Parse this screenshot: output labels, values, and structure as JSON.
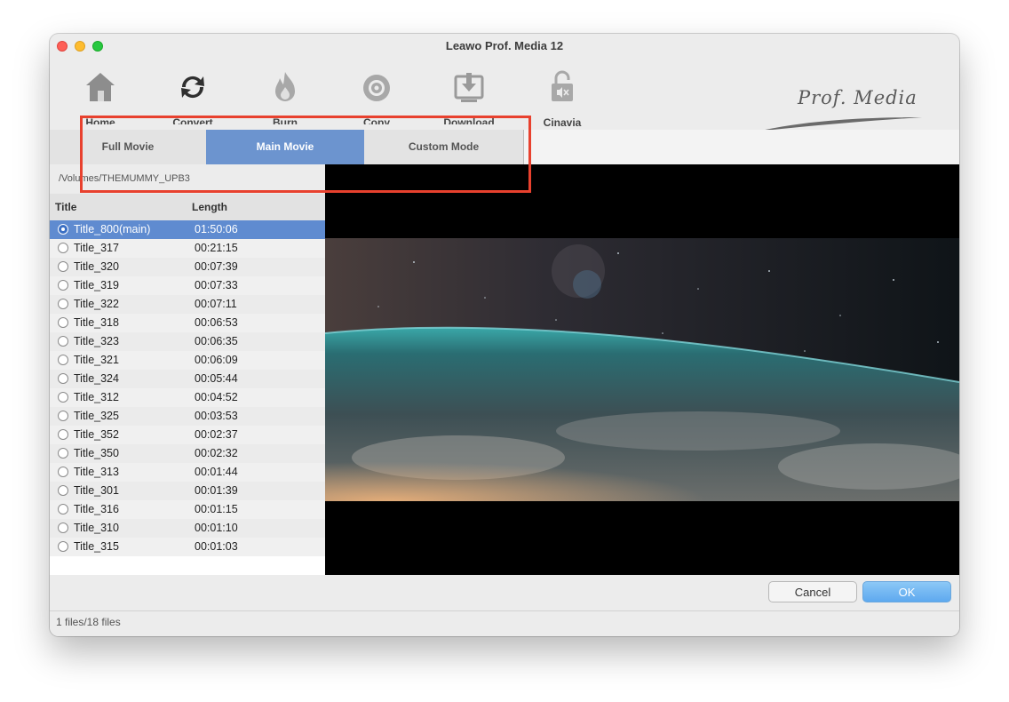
{
  "window": {
    "title": "Leawo Prof. Media 12"
  },
  "toolbar": {
    "items": [
      {
        "label": "Home",
        "icon": "home-icon"
      },
      {
        "label": "Convert",
        "icon": "convert-icon"
      },
      {
        "label": "Burn",
        "icon": "burn-icon"
      },
      {
        "label": "Copy",
        "icon": "copy-icon"
      },
      {
        "label": "Download",
        "icon": "download-icon"
      },
      {
        "label": "Cinavia",
        "icon": "cinavia-icon"
      }
    ],
    "logo_text": "Prof. Media"
  },
  "tabs": [
    {
      "label": "Full Movie",
      "active": false
    },
    {
      "label": "Main Movie",
      "active": true
    },
    {
      "label": "Custom Mode",
      "active": false
    }
  ],
  "path": "/Volumes/THEMUMMY_UPB3",
  "list": {
    "headers": {
      "title": "Title",
      "length": "Length"
    },
    "rows": [
      {
        "title": "Title_800(main)",
        "length": "01:50:06",
        "selected": true
      },
      {
        "title": "Title_317",
        "length": "00:21:15",
        "selected": false
      },
      {
        "title": "Title_320",
        "length": "00:07:39",
        "selected": false
      },
      {
        "title": "Title_319",
        "length": "00:07:33",
        "selected": false
      },
      {
        "title": "Title_322",
        "length": "00:07:11",
        "selected": false
      },
      {
        "title": "Title_318",
        "length": "00:06:53",
        "selected": false
      },
      {
        "title": "Title_323",
        "length": "00:06:35",
        "selected": false
      },
      {
        "title": "Title_321",
        "length": "00:06:09",
        "selected": false
      },
      {
        "title": "Title_324",
        "length": "00:05:44",
        "selected": false
      },
      {
        "title": "Title_312",
        "length": "00:04:52",
        "selected": false
      },
      {
        "title": "Title_325",
        "length": "00:03:53",
        "selected": false
      },
      {
        "title": "Title_352",
        "length": "00:02:37",
        "selected": false
      },
      {
        "title": "Title_350",
        "length": "00:02:32",
        "selected": false
      },
      {
        "title": "Title_313",
        "length": "00:01:44",
        "selected": false
      },
      {
        "title": "Title_301",
        "length": "00:01:39",
        "selected": false
      },
      {
        "title": "Title_316",
        "length": "00:01:15",
        "selected": false
      },
      {
        "title": "Title_310",
        "length": "00:01:10",
        "selected": false
      },
      {
        "title": "Title_315",
        "length": "00:01:03",
        "selected": false
      }
    ]
  },
  "buttons": {
    "cancel": "Cancel",
    "ok": "OK"
  },
  "status": "1 files/18 files",
  "colors": {
    "accent": "#6c94cf",
    "selection": "#5f8bd0",
    "highlight_box": "#e8412e"
  }
}
